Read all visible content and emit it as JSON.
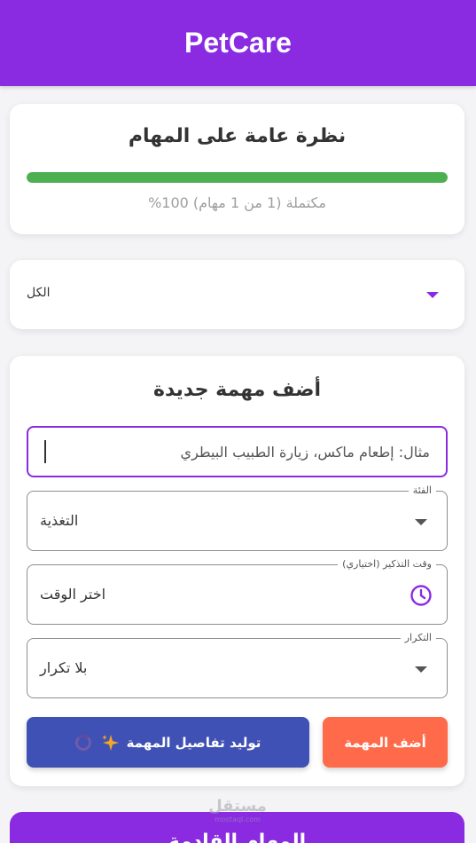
{
  "app_bar": {
    "title": "PetCare"
  },
  "overview": {
    "heading": "نظرة عامة على المهام",
    "progress_fraction": 1.0,
    "progress_text": "مكتملة (1 من 1 مهام) 100%"
  },
  "filter": {
    "selected": "الكل"
  },
  "add_task": {
    "heading": "أضف مهمة جديدة",
    "task_placeholder": "مثال: إطعام ماكس، زيارة الطبيب البيطري",
    "category": {
      "label": "الفئة",
      "value": "التغذية"
    },
    "reminder_time": {
      "label": "وقت التذكير (اختياري)",
      "value": "اختر الوقت"
    },
    "repeat": {
      "label": "التكرار",
      "value": "بلا تكرار"
    },
    "add_button": "أضف المهمة",
    "generate_button": "توليد تفاصيل المهمة"
  },
  "next_section": {
    "heading": "المهام القادمة"
  },
  "watermark": {
    "arabic": "مستقل",
    "latin": "mostaql.com"
  },
  "colors": {
    "primary": "#8a2be2",
    "progress": "#4caf50",
    "add_button": "#ff6b4a",
    "generate_button": "#3f51b5",
    "sparkle": "#f5a623"
  }
}
